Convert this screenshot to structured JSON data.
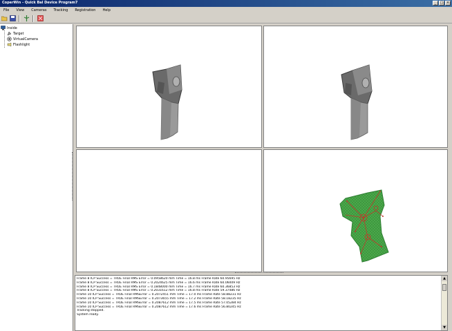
{
  "window": {
    "title": "CoperWin - Quick Bal Device Program7"
  },
  "menu": [
    "File",
    "View",
    "Cameras",
    "Tracking",
    "Registration",
    "Help"
  ],
  "tree": {
    "root": "Inside",
    "items": [
      "Target",
      "VirtualCamera",
      "Flashlight"
    ]
  },
  "log": {
    "lines": [
      "Frame 8 ICP Success = TRUE Final RMS Error = 0.0958620 mm Time = 16.8 ms Frame Rate 60.95695 Hz",
      "Frame 8 ICP Success = TRUE Final RMS Error = 0.2024625 mm Time = 16.6 ms Frame Rate 60.06009 Hz",
      "Frame 8 ICP Success = TRUE Final RMS Error = 0.1848000 mm Time = 16.7 ms Frame Rate 60.36853 Hz",
      "Frame 8 ICP Success = TRUE Final RMS Error = 0.2031612 mm Time = 16.8 ms Frame Rate 59.37486 Hz",
      "Frame 10 ICP Success = TRUE Final RMSError = 0.2072451 mm Time = 17.0 ms Frame Rate 58.88231 Hz",
      "Frame 10 ICP Success = TRUE Final RMSError = 0.2073655 mm Time = 17.2 ms Frame Rate 58.18235 Hz",
      "Frame 10 ICP Success = TRUE Final RMSError = 0.2087612 mm Time = 17.5 ms Frame Rate 57.05284 Hz",
      "Frame 10 ICP Success = TRUE Final RMSError = 0.2087612 mm Time = 17.6 ms Frame Rate 56.80245 Hz",
      "Tracking stopped.",
      "System ready."
    ]
  },
  "icons": {
    "open": "folder-open-icon",
    "save": "save-icon",
    "target": "target-icon",
    "stop": "stop-icon"
  },
  "colors": {
    "title_gradient_start": "#0a246a",
    "title_gradient_end": "#3a6ea5",
    "mesh_green": "#4aa84a",
    "overlay_red": "#c0392b"
  }
}
